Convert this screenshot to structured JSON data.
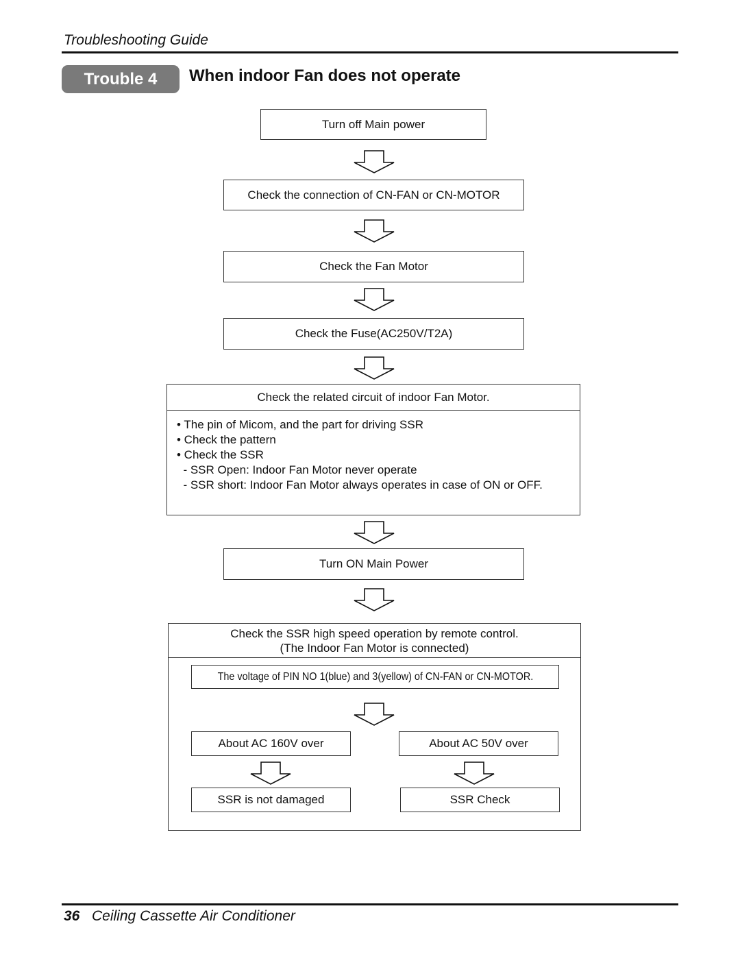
{
  "header": {
    "guide_title": "Troubleshooting Guide",
    "badge": "Trouble 4",
    "section_title": "When indoor Fan does not operate"
  },
  "flow": {
    "step1": "Turn off Main power",
    "step2": "Check the connection of CN-FAN or CN-MOTOR",
    "step3": "Check the Fan Motor",
    "step4": "Check the Fuse(AC250V/T2A)",
    "circuit_panel": {
      "title": "Check the related circuit of indoor Fan Motor.",
      "lines": [
        "• The pin of Micom, and the part for driving SSR",
        "• Check the pattern",
        "• Check the SSR",
        "  - SSR Open: Indoor Fan Motor never operate",
        "  - SSR short: Indoor Fan Motor always operates in case of ON or OFF."
      ]
    },
    "step5": "Turn ON Main Power",
    "ssr_panel": {
      "title_line1": "Check the SSR high speed operation by remote control.",
      "title_line2": "(The Indoor Fan Motor is connected)",
      "voltage_check": "The voltage of PIN NO 1(blue) and 3(yellow) of CN-FAN or CN-MOTOR.",
      "left_condition": "About AC 160V over",
      "left_result": "SSR is not damaged",
      "right_condition": "About AC 50V over",
      "right_result": "SSR Check"
    }
  },
  "footer": {
    "page_number": "36",
    "manual_title": "Ceiling Cassette Air Conditioner"
  },
  "icons": {
    "arrow": "down-arrow-icon"
  }
}
